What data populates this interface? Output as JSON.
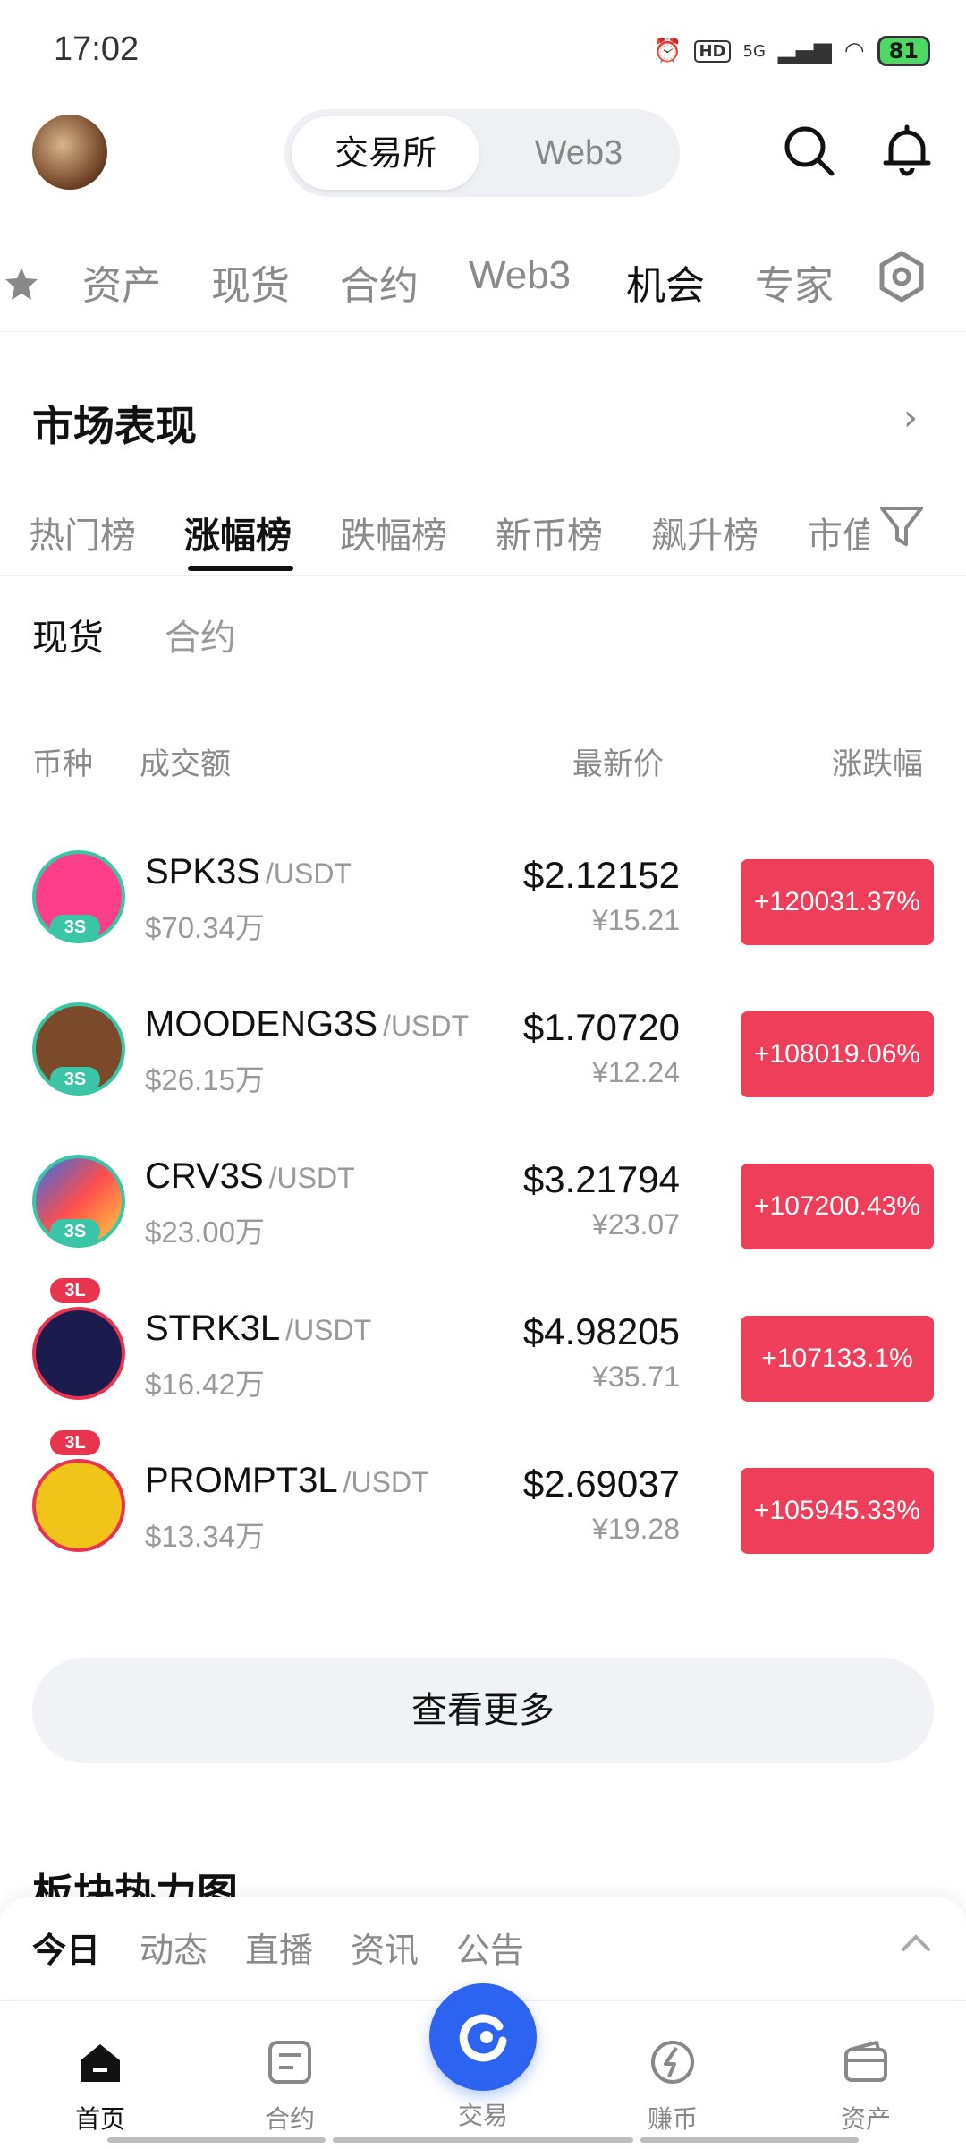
{
  "status": {
    "time": "17:02",
    "network": "5G",
    "hd": "HD",
    "battery": "81"
  },
  "header": {
    "segments": [
      "交易所",
      "Web3"
    ]
  },
  "nav_tabs": [
    "资产",
    "现货",
    "合约",
    "Web3",
    "机会",
    "专家"
  ],
  "market": {
    "title": "市场表现",
    "rank_tabs": [
      "热门榜",
      "涨幅榜",
      "跌幅榜",
      "新币榜",
      "飙升榜",
      "市值"
    ],
    "sub_tabs": [
      "现货",
      "合约"
    ],
    "columns": {
      "coin": "币种",
      "volume": "成交额",
      "price": "最新价",
      "change": "涨跌幅"
    },
    "rows": [
      {
        "symbol": "SPK3S",
        "quote": "/USDT",
        "volume": "$70.34万",
        "price": "$2.12152",
        "cny": "¥15.21",
        "change": "+120031.37%",
        "badge": "3S",
        "color": "#ff3e8a"
      },
      {
        "symbol": "MOODENG3S",
        "quote": "/USDT",
        "volume": "$26.15万",
        "price": "$1.70720",
        "cny": "¥12.24",
        "change": "+108019.06%",
        "badge": "3S",
        "color": "#7a4a2a"
      },
      {
        "symbol": "CRV3S",
        "quote": "/USDT",
        "volume": "$23.00万",
        "price": "$3.21794",
        "cny": "¥23.07",
        "change": "+107200.43%",
        "badge": "3S",
        "color": "#2f6fe8"
      },
      {
        "symbol": "STRK3L",
        "quote": "/USDT",
        "volume": "$16.42万",
        "price": "$4.98205",
        "cny": "¥35.71",
        "change": "+107133.1%",
        "badge": "3L",
        "color": "#1b1b4d"
      },
      {
        "symbol": "PROMPT3L",
        "quote": "/USDT",
        "volume": "$13.34万",
        "price": "$2.69037",
        "cny": "¥19.28",
        "change": "+105945.33%",
        "badge": "3L",
        "color": "#f0c419"
      }
    ],
    "more_label": "查看更多"
  },
  "heatmap": {
    "title": "板块热力图"
  },
  "feed_tabs": [
    "今日",
    "动态",
    "直播",
    "资讯",
    "公告"
  ],
  "bottom_nav": [
    "首页",
    "合约",
    "交易",
    "赚币",
    "资产"
  ]
}
